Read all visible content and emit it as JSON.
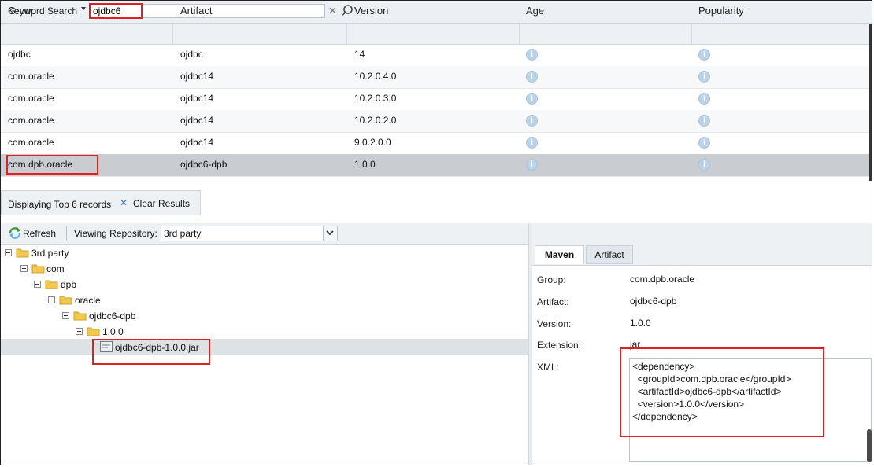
{
  "search": {
    "label": "Keyword Search",
    "value": "ojdbc6"
  },
  "grid": {
    "columns": [
      "Group",
      "Artifact",
      "Version",
      "Age",
      "Popularity"
    ],
    "rows": [
      {
        "group": "ojdbc",
        "artifact": "ojdbc",
        "version": "14"
      },
      {
        "group": "com.oracle",
        "artifact": "ojdbc14",
        "version": "10.2.0.4.0"
      },
      {
        "group": "com.oracle",
        "artifact": "ojdbc14",
        "version": "10.2.0.3.0"
      },
      {
        "group": "com.oracle",
        "artifact": "ojdbc14",
        "version": "10.2.0.2.0"
      },
      {
        "group": "com.oracle",
        "artifact": "ojdbc14",
        "version": "9.0.2.0.0"
      },
      {
        "group": "com.dpb.oracle",
        "artifact": "ojdbc6-dpb",
        "version": "1.0.0"
      }
    ],
    "selected_row": 5
  },
  "status": {
    "text": "Displaying Top 6 records",
    "clear_label": "Clear Results"
  },
  "toolbar": {
    "refresh_label": "Refresh",
    "repo_label": "Viewing Repository:",
    "repo_value": "3rd party"
  },
  "tree": [
    {
      "label": "3rd party",
      "type": "folder"
    },
    {
      "label": "com",
      "type": "folder"
    },
    {
      "label": "dpb",
      "type": "folder"
    },
    {
      "label": "oracle",
      "type": "folder"
    },
    {
      "label": "ojdbc6-dpb",
      "type": "folder"
    },
    {
      "label": "1.0.0",
      "type": "folder"
    },
    {
      "label": "ojdbc6-dpb-1.0.0.jar",
      "type": "file"
    }
  ],
  "details": {
    "tabs": [
      "Maven",
      "Artifact"
    ],
    "active_tab": "Maven",
    "group_label": "Group:",
    "group_value": "com.dpb.oracle",
    "artifact_label": "Artifact:",
    "artifact_value": "ojdbc6-dpb",
    "version_label": "Version:",
    "version_value": "1.0.0",
    "extension_label": "Extension:",
    "extension_value": "jar",
    "xml_label": "XML:",
    "xml_lines": [
      "<dependency>",
      "  <groupId>com.dpb.oracle</groupId>",
      "  <artifactId>ojdbc6-dpb</artifactId>",
      "  <version>1.0.0</version>",
      "</dependency>"
    ]
  },
  "colors": {
    "annotation": "#e0201e",
    "selected_row": "#c9cdd1",
    "info_icon": "#bcd3e6",
    "folder": "#f2c94c"
  }
}
